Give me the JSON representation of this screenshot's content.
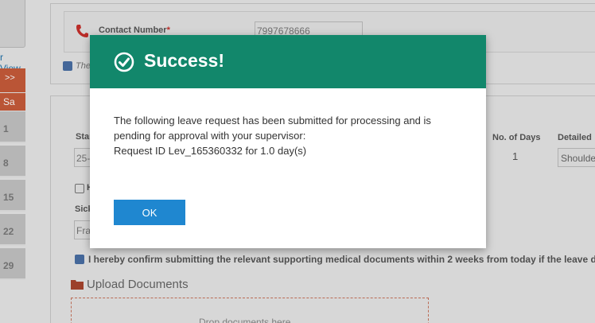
{
  "calendar": {
    "view_link": "r View",
    "nav": ">>",
    "day_header": "Sa",
    "days": [
      "1",
      "8",
      "15",
      "22",
      "29"
    ]
  },
  "contact": {
    "label": "Contact Number",
    "required_mark": "*",
    "value": "7997678666",
    "checkbox_text": "The"
  },
  "leave_form": {
    "start_label": "Star",
    "start_value": "25-",
    "half_day_label": "H",
    "sick_label": "Sick",
    "sick_value": "Fra",
    "days_label": "No. of Days",
    "days_value": "1",
    "detailed_label": "Detailed",
    "detailed_value": "Shoulde",
    "confirm_text": "I hereby confirm submitting the relevant supporting medical documents within 2 weeks from today if the leave d",
    "upload_title": "Upload Documents",
    "dropzone_text": "Drop documents here"
  },
  "modal": {
    "title": "Success!",
    "message_line1": "The following leave request has been submitted for processing and is",
    "message_line2": "pending for approval with your supervisor:",
    "message_line3": "Request ID Lev_165360332 for 1.0 day(s)",
    "ok_label": "OK"
  },
  "colors": {
    "modal_header": "#12876b",
    "ok_button": "#1f87d0",
    "calendar_accent": "#c95c3b"
  },
  "icons": {
    "success": "check-circle-icon",
    "phone": "phone-icon",
    "folder": "folder-icon"
  }
}
